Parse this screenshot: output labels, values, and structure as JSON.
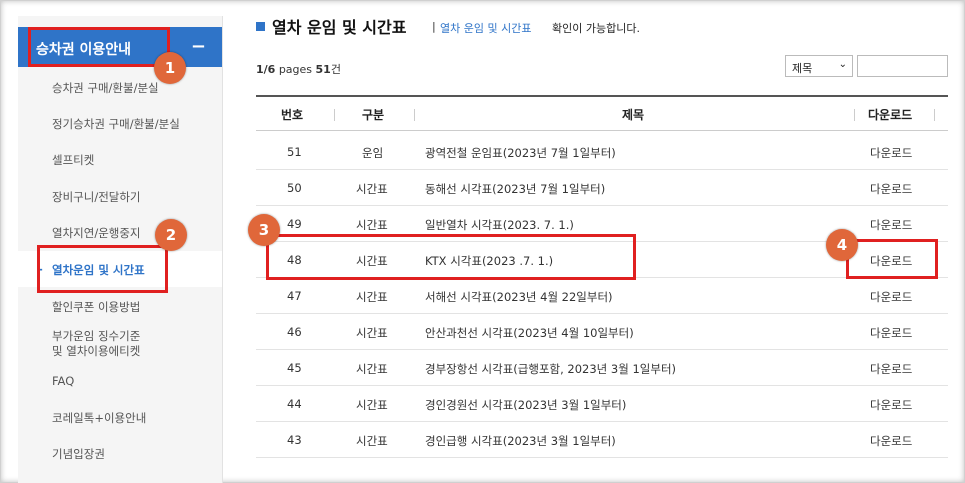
{
  "sidebar": {
    "header": "승차권 이용안내",
    "collapse": "−",
    "items": [
      {
        "label": "승차권 구매/환불/분실"
      },
      {
        "label": "정기승차권 구매/환불/분실"
      },
      {
        "label": "셀프티켓"
      },
      {
        "label": "장비구니/전달하기"
      },
      {
        "label": "열차지연/운행중지"
      },
      {
        "label": "열차운임 및 시간표",
        "active": true,
        "bullet": "-"
      },
      {
        "label": "할인쿠폰 이용방법"
      },
      {
        "label": "부가운임 징수기준\n및 열차이용에티켓"
      },
      {
        "label": "FAQ"
      },
      {
        "label": "코레일톡+이용안내"
      },
      {
        "label": "기념입장권"
      }
    ]
  },
  "main": {
    "title": "열차 운임 및 시간표",
    "title_sep": "|",
    "desc_link": "열차 운임 및 시간표",
    "desc": "확인이 가능합니다.",
    "count_pages": "1/6",
    "count_pages_label": " pages ",
    "count_total": "51",
    "count_unit": "건",
    "select_value": "제목",
    "select_chevron": "⌄",
    "columns": [
      "번호",
      "구분",
      "제목",
      "다운로드"
    ],
    "rows": [
      {
        "no": "51",
        "type": "운임",
        "title": "광역전철 운임표(2023년 7월 1일부터)",
        "dl": "다운로드"
      },
      {
        "no": "50",
        "type": "시간표",
        "title": "동해선 시각표(2023년 7월 1일부터)",
        "dl": "다운로드"
      },
      {
        "no": "49",
        "type": "시간표",
        "title": "일반열차 시각표(2023. 7. 1.)",
        "dl": "다운로드"
      },
      {
        "no": "48",
        "type": "시간표",
        "title": "KTX 시각표(2023 .7. 1.)",
        "dl": "다운로드"
      },
      {
        "no": "47",
        "type": "시간표",
        "title": "서해선 시각표(2023년 4월 22일부터)",
        "dl": "다운로드"
      },
      {
        "no": "46",
        "type": "시간표",
        "title": "안산과천선 시각표(2023년 4월 10일부터)",
        "dl": "다운로드"
      },
      {
        "no": "45",
        "type": "시간표",
        "title": "경부장항선 시각표(급행포함, 2023년 3월 1일부터)",
        "dl": "다운로드"
      },
      {
        "no": "44",
        "type": "시간표",
        "title": "경인경원선 시각표(2023년 3월 1일부터)",
        "dl": "다운로드"
      },
      {
        "no": "43",
        "type": "시간표",
        "title": "경인급행 시각표(2023년 3월 1일부터)",
        "dl": "다운로드"
      }
    ]
  },
  "callouts": [
    "1",
    "2",
    "3",
    "4"
  ],
  "colors": {
    "accent": "#2f74c8",
    "highlight": "#e02020",
    "badge": "#e0673a"
  }
}
